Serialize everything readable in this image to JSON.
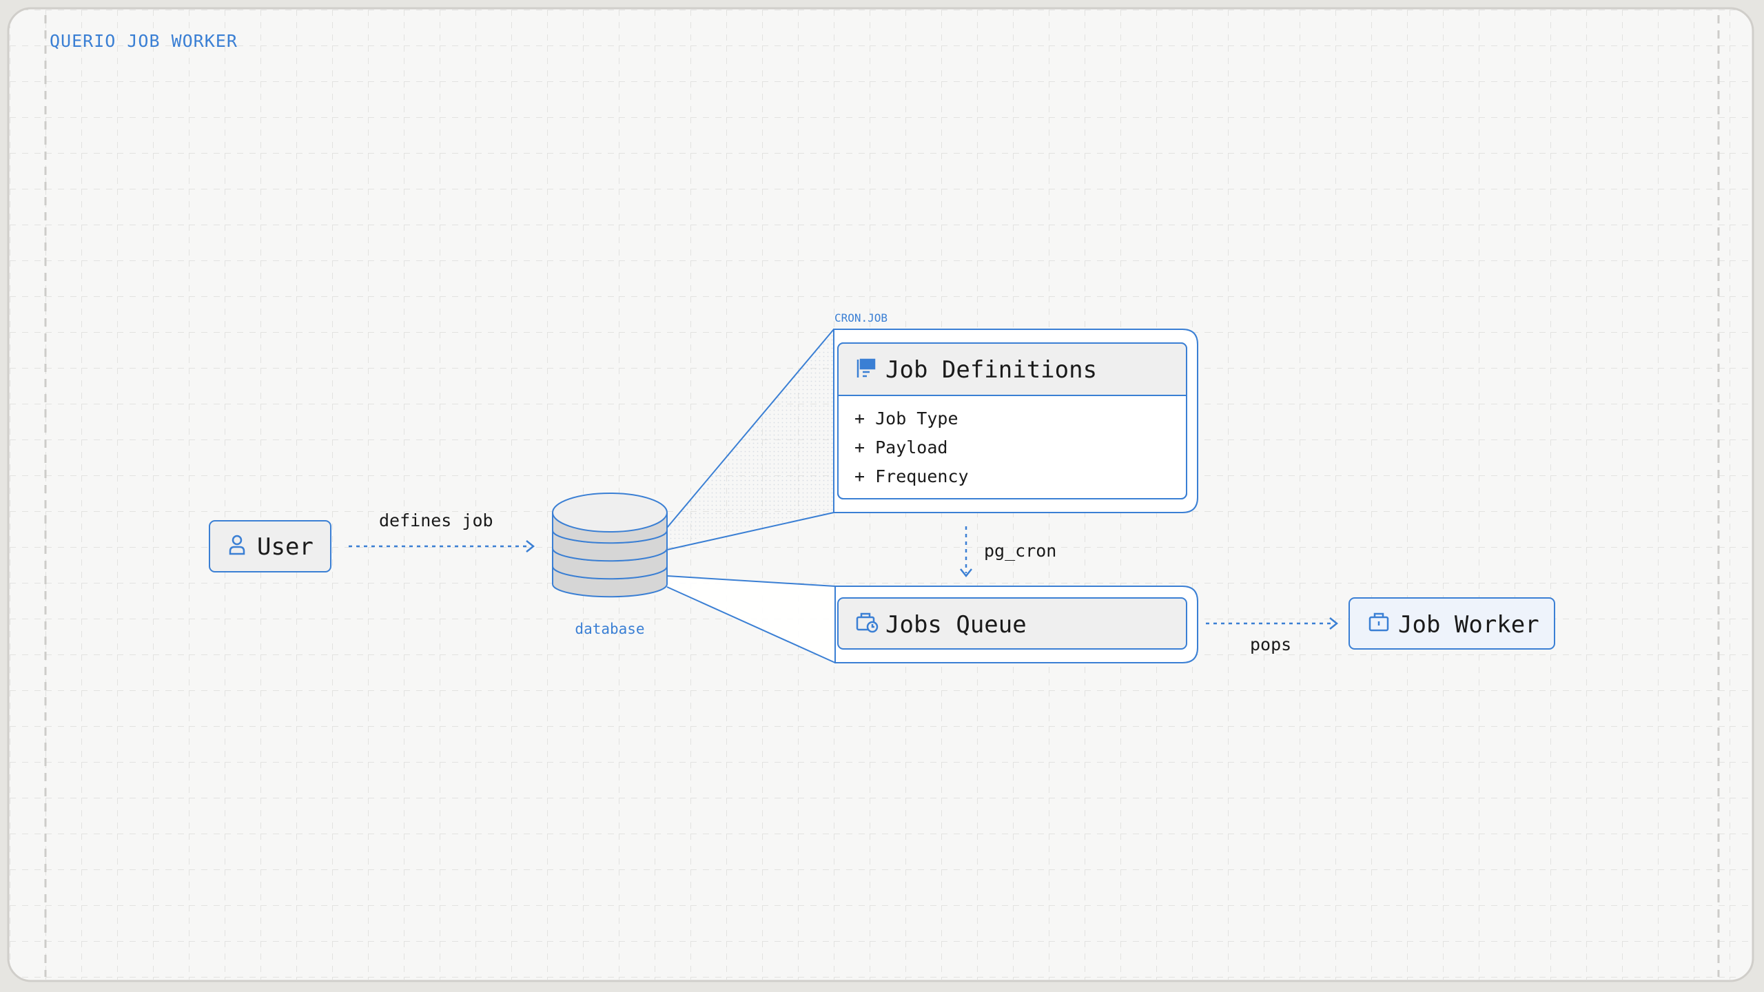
{
  "diagram": {
    "title": "QUERIO JOB WORKER",
    "group_label": "CRON.JOB",
    "user": {
      "label": "User",
      "icon": "user-icon"
    },
    "database": {
      "label": "database",
      "icon": "database-icon"
    },
    "job_definitions": {
      "title": "Job Definitions",
      "icon": "document-flag-icon",
      "fields": [
        "+ Job Type",
        "+ Payload",
        "+ Frequency"
      ]
    },
    "jobs_queue": {
      "title": "Jobs Queue",
      "icon": "briefcase-clock-icon"
    },
    "job_worker": {
      "title": "Job Worker",
      "icon": "briefcase-icon"
    },
    "edges": {
      "user_to_db": "defines job",
      "defs_to_queue": "pg_cron",
      "queue_to_worker": "pops"
    }
  },
  "colors": {
    "accent": "#3a7fd4",
    "node_fill": "#efefef",
    "worker_fill": "#eef3fb",
    "background": "#f7f7f6"
  }
}
